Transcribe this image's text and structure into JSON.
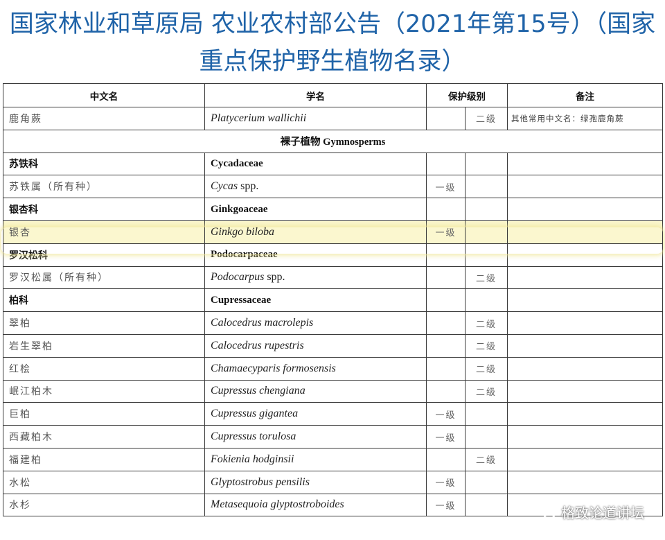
{
  "title": {
    "line1": "国家林业和草原局 农业农村部公告（2021年第15号）（国家",
    "line2": "重点保护野生植物名录）"
  },
  "table": {
    "headers": [
      "中文名",
      "学名",
      "保护级别",
      "备注"
    ],
    "rows": [
      {
        "type": "species",
        "cn": "鹿角蕨",
        "sci": "Platycerium wallichii",
        "spp": "",
        "level1": "",
        "level2": "二级",
        "remark": "其他常用中文名：绿孢鹿角蕨"
      },
      {
        "type": "section",
        "text": "裸子植物 Gymnosperms"
      },
      {
        "type": "family",
        "cn": "苏铁科",
        "sci": "Cycadaceae"
      },
      {
        "type": "species",
        "cn": "苏铁属（所有种）",
        "sci": "Cycas",
        "spp": " spp.",
        "level1": "一级",
        "level2": "",
        "remark": ""
      },
      {
        "type": "family",
        "cn": "银杏科",
        "sci": "Ginkgoaceae"
      },
      {
        "type": "species",
        "cn": "银杏",
        "sci": "Ginkgo biloba",
        "spp": "",
        "level1": "一级",
        "level2": "",
        "remark": "",
        "highlight": true
      },
      {
        "type": "family",
        "cn": "罗汉松科",
        "sci": "Podocarpaceae"
      },
      {
        "type": "species",
        "cn": "罗汉松属（所有种）",
        "sci": "Podocarpus",
        "spp": " spp.",
        "level1": "",
        "level2": "二级",
        "remark": ""
      },
      {
        "type": "family",
        "cn": "柏科",
        "sci": "Cupressaceae"
      },
      {
        "type": "species",
        "cn": "翠柏",
        "sci": "Calocedrus macrolepis",
        "spp": "",
        "level1": "",
        "level2": "二级",
        "remark": ""
      },
      {
        "type": "species",
        "cn": "岩生翠柏",
        "sci": "Calocedrus rupestris",
        "spp": "",
        "level1": "",
        "level2": "二级",
        "remark": ""
      },
      {
        "type": "species",
        "cn": "红桧",
        "sci": "Chamaecyparis formosensis",
        "spp": "",
        "level1": "",
        "level2": "二级",
        "remark": ""
      },
      {
        "type": "species",
        "cn": "岷江柏木",
        "sci": "Cupressus chengiana",
        "spp": "",
        "level1": "",
        "level2": "二级",
        "remark": ""
      },
      {
        "type": "species",
        "cn": "巨柏",
        "sci": "Cupressus gigantea",
        "spp": "",
        "level1": "一级",
        "level2": "",
        "remark": ""
      },
      {
        "type": "species",
        "cn": "西藏柏木",
        "sci": "Cupressus torulosa",
        "spp": "",
        "level1": "一级",
        "level2": "",
        "remark": ""
      },
      {
        "type": "species",
        "cn": "福建柏",
        "sci": "Fokienia hodginsii",
        "spp": "",
        "level1": "",
        "level2": "二级",
        "remark": ""
      },
      {
        "type": "species",
        "cn": "水松",
        "sci": "Glyptostrobus pensilis",
        "spp": "",
        "level1": "一级",
        "level2": "",
        "remark": ""
      },
      {
        "type": "species",
        "cn": "水杉",
        "sci": "Metasequoia glyptostroboides",
        "spp": "",
        "level1": "一级",
        "level2": "",
        "remark": ""
      }
    ]
  },
  "watermark": {
    "icon": "wechat-icon",
    "text": "格致论道讲坛"
  },
  "colors": {
    "title": "#1f63a8",
    "highlight": "#fbf7cf"
  }
}
